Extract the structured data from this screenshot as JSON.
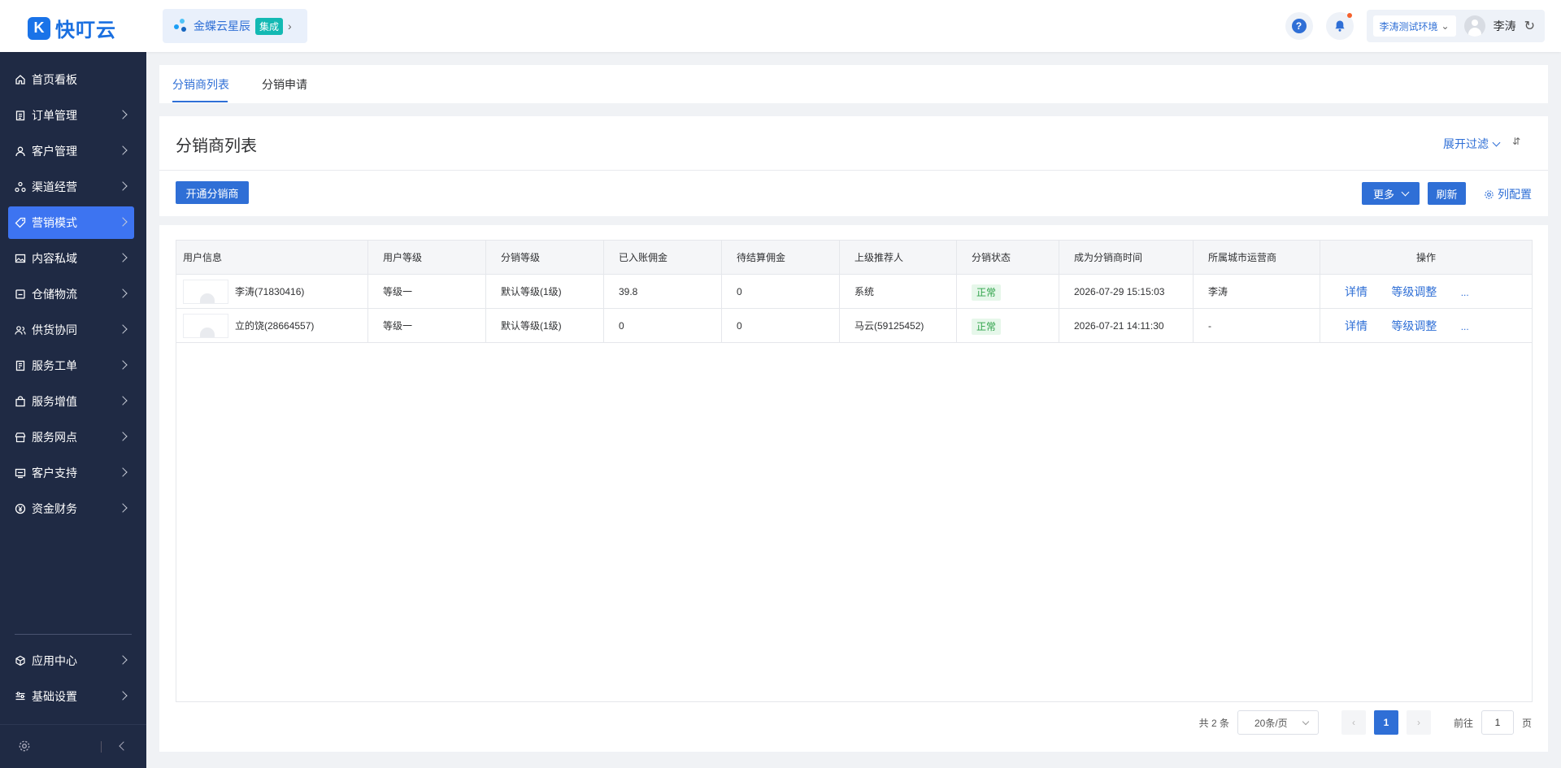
{
  "brand": {
    "logo_glyph": "K",
    "name": "快叮云"
  },
  "integration": {
    "label": "金蝶云星辰",
    "badge": "集成",
    "chevron": "›"
  },
  "header": {
    "help_glyph": "?",
    "env_label": "李涛测试环境",
    "env_chevron": "⌄",
    "user_name": "李涛",
    "refresh_glyph": "↻"
  },
  "sidebar": {
    "items": [
      {
        "label": "首页看板",
        "icon": "home-icon",
        "chevron": false,
        "active": false
      },
      {
        "label": "订单管理",
        "icon": "clipboard-icon",
        "chevron": true,
        "active": false
      },
      {
        "label": "客户管理",
        "icon": "user-icon",
        "chevron": true,
        "active": false
      },
      {
        "label": "渠道经营",
        "icon": "channel-icon",
        "chevron": true,
        "active": false
      },
      {
        "label": "营销模式",
        "icon": "tag-icon",
        "chevron": true,
        "active": true
      },
      {
        "label": "内容私域",
        "icon": "image-icon",
        "chevron": true,
        "active": false
      },
      {
        "label": "仓储物流",
        "icon": "warehouse-icon",
        "chevron": true,
        "active": false
      },
      {
        "label": "供货协同",
        "icon": "supply-icon",
        "chevron": true,
        "active": false
      },
      {
        "label": "服务工单",
        "icon": "ticket-icon",
        "chevron": true,
        "active": false
      },
      {
        "label": "服务增值",
        "icon": "bag-icon",
        "chevron": true,
        "active": false
      },
      {
        "label": "服务网点",
        "icon": "store-icon",
        "chevron": true,
        "active": false
      },
      {
        "label": "客户支持",
        "icon": "support-icon",
        "chevron": true,
        "active": false
      },
      {
        "label": "资金财务",
        "icon": "yen-icon",
        "chevron": true,
        "active": false
      }
    ],
    "bottom_items": [
      {
        "label": "应用中心",
        "icon": "cube-icon",
        "chevron": true
      },
      {
        "label": "基础设置",
        "icon": "sliders-icon",
        "chevron": true
      }
    ]
  },
  "tabs": [
    {
      "label": "分销商列表",
      "active": true
    },
    {
      "label": "分销申请",
      "active": false
    }
  ],
  "list": {
    "title": "分销商列表",
    "filter_label": "展开过滤",
    "open_button": "开通分销商",
    "more_button": "更多",
    "refresh_button": "刷新",
    "column_config": "列配置"
  },
  "table": {
    "columns": [
      "用户信息",
      "用户等级",
      "分销等级",
      "已入账佣金",
      "待结算佣金",
      "上级推荐人",
      "分销状态",
      "成为分销商时间",
      "所属城市运营商",
      "操作"
    ],
    "rows": [
      {
        "user": "李涛(71830416)",
        "user_level": "等级一",
        "dist_level": "默认等级(1级)",
        "booked": "39.8",
        "pending": "0",
        "referrer": "系统",
        "status": "正常",
        "joined": "2026-07-29 15:15:03",
        "city_op": "李涛"
      },
      {
        "user": "立的饶(28664557)",
        "user_level": "等级一",
        "dist_level": "默认等级(1级)",
        "booked": "0",
        "pending": "0",
        "referrer": "马云(59125452)",
        "status": "正常",
        "joined": "2026-07-21 14:11:30",
        "city_op": "-"
      }
    ],
    "actions": {
      "detail": "详情",
      "adjust": "等级调整",
      "more": "..."
    }
  },
  "pagination": {
    "total_text": "共 2 条",
    "page_size": "20条/页",
    "prev": "‹",
    "current": "1",
    "next": "›",
    "goto_label": "前往",
    "goto_value": "1",
    "page_unit": "页"
  },
  "colors": {
    "primary": "#2f6fd6",
    "sidebar_bg": "#1f2a44",
    "active_nav": "#3d74f1",
    "status_ok": "#2fa34a"
  }
}
